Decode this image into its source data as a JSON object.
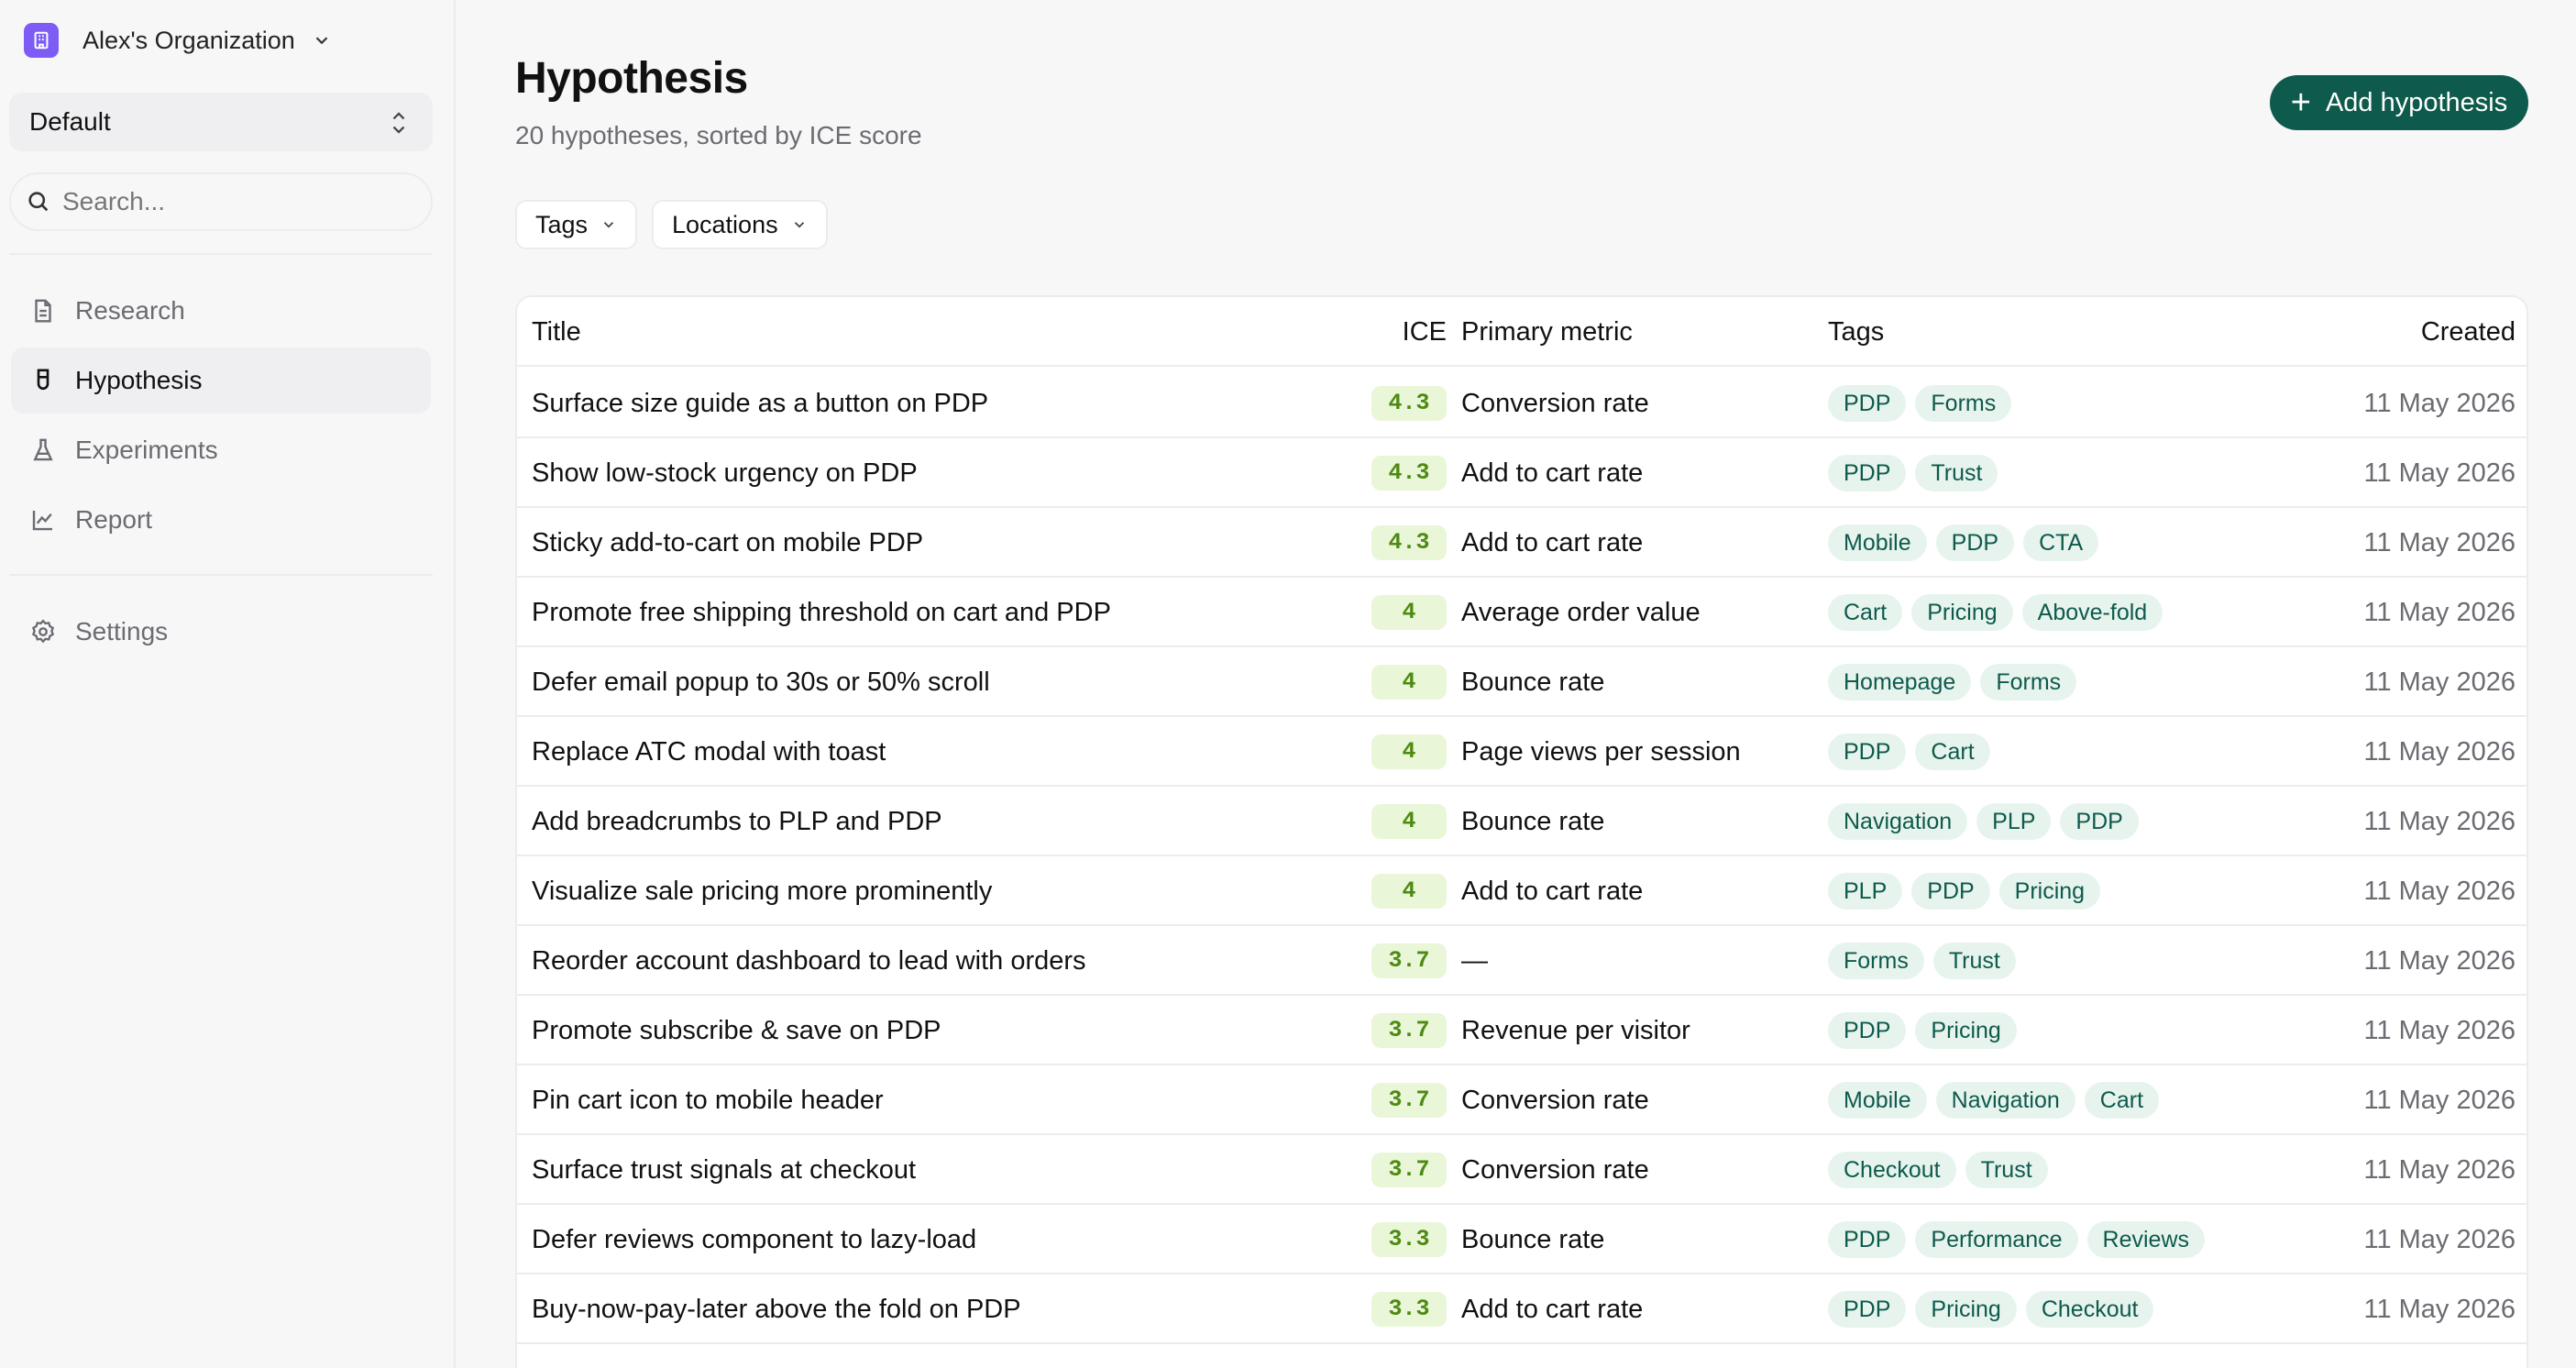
{
  "sidebar": {
    "org_name": "Alex's Organization",
    "workspace": "Default",
    "search_placeholder": "Search...",
    "nav": [
      {
        "label": "Research",
        "icon": "document-icon",
        "active": false
      },
      {
        "label": "Hypothesis",
        "icon": "flask-icon",
        "active": true
      },
      {
        "label": "Experiments",
        "icon": "beaker-icon",
        "active": false
      },
      {
        "label": "Report",
        "icon": "line-chart-icon",
        "active": false
      }
    ],
    "settings_label": "Settings"
  },
  "header": {
    "title": "Hypothesis",
    "subtitle": "20 hypotheses, sorted by ICE score",
    "add_button": "Add hypothesis"
  },
  "filters": {
    "tags": "Tags",
    "locations": "Locations"
  },
  "table": {
    "columns": {
      "title": "Title",
      "ice": "ICE",
      "metric": "Primary metric",
      "tags": "Tags",
      "created": "Created"
    },
    "rows": [
      {
        "title": "Surface size guide as a button on PDP",
        "ice": "4.3",
        "metric": "Conversion rate",
        "tags": [
          "PDP",
          "Forms"
        ],
        "created": "11 May 2026"
      },
      {
        "title": "Show low-stock urgency on PDP",
        "ice": "4.3",
        "metric": "Add to cart rate",
        "tags": [
          "PDP",
          "Trust"
        ],
        "created": "11 May 2026"
      },
      {
        "title": "Sticky add-to-cart on mobile PDP",
        "ice": "4.3",
        "metric": "Add to cart rate",
        "tags": [
          "Mobile",
          "PDP",
          "CTA"
        ],
        "created": "11 May 2026"
      },
      {
        "title": "Promote free shipping threshold on cart and PDP",
        "ice": "4",
        "metric": "Average order value",
        "tags": [
          "Cart",
          "Pricing",
          "Above-fold"
        ],
        "created": "11 May 2026"
      },
      {
        "title": "Defer email popup to 30s or 50% scroll",
        "ice": "4",
        "metric": "Bounce rate",
        "tags": [
          "Homepage",
          "Forms"
        ],
        "created": "11 May 2026"
      },
      {
        "title": "Replace ATC modal with toast",
        "ice": "4",
        "metric": "Page views per session",
        "tags": [
          "PDP",
          "Cart"
        ],
        "created": "11 May 2026"
      },
      {
        "title": "Add breadcrumbs to PLP and PDP",
        "ice": "4",
        "metric": "Bounce rate",
        "tags": [
          "Navigation",
          "PLP",
          "PDP"
        ],
        "created": "11 May 2026"
      },
      {
        "title": "Visualize sale pricing more prominently",
        "ice": "4",
        "metric": "Add to cart rate",
        "tags": [
          "PLP",
          "PDP",
          "Pricing"
        ],
        "created": "11 May 2026"
      },
      {
        "title": "Reorder account dashboard to lead with orders",
        "ice": "3.7",
        "metric": "—",
        "tags": [
          "Forms",
          "Trust"
        ],
        "created": "11 May 2026"
      },
      {
        "title": "Promote subscribe & save on PDP",
        "ice": "3.7",
        "metric": "Revenue per visitor",
        "tags": [
          "PDP",
          "Pricing"
        ],
        "created": "11 May 2026"
      },
      {
        "title": "Pin cart icon to mobile header",
        "ice": "3.7",
        "metric": "Conversion rate",
        "tags": [
          "Mobile",
          "Navigation",
          "Cart"
        ],
        "created": "11 May 2026"
      },
      {
        "title": "Surface trust signals at checkout",
        "ice": "3.7",
        "metric": "Conversion rate",
        "tags": [
          "Checkout",
          "Trust"
        ],
        "created": "11 May 2026"
      },
      {
        "title": "Defer reviews component to lazy-load",
        "ice": "3.3",
        "metric": "Bounce rate",
        "tags": [
          "PDP",
          "Performance",
          "Reviews"
        ],
        "created": "11 May 2026"
      },
      {
        "title": "Buy-now-pay-later above the fold on PDP",
        "ice": "3.3",
        "metric": "Add to cart rate",
        "tags": [
          "PDP",
          "Pricing",
          "Checkout"
        ],
        "created": "11 May 2026"
      }
    ]
  }
}
